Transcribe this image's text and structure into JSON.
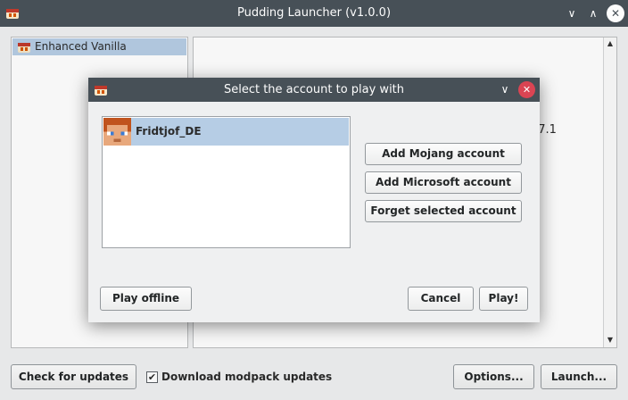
{
  "window": {
    "title": "Pudding Launcher (v1.0.0)",
    "controls": {
      "minimize": "∨",
      "maximize": "∧",
      "close": "✕"
    }
  },
  "modpacks": {
    "items": [
      {
        "label": "Enhanced Vanilla"
      }
    ]
  },
  "info_panel": {
    "visible_text": "17.1"
  },
  "bottom_bar": {
    "check_updates": "Check for updates",
    "download_updates_label": "Download modpack updates",
    "download_updates_checked": true,
    "options": "Options...",
    "launch": "Launch..."
  },
  "dialog": {
    "title": "Select the account to play with",
    "accounts": [
      {
        "name": "Fridtjof_DE",
        "selected": true
      }
    ],
    "buttons": {
      "add_mojang": "Add Mojang account",
      "add_microsoft": "Add Microsoft account",
      "forget_selected": "Forget selected account",
      "play_offline": "Play offline",
      "cancel": "Cancel",
      "play": "Play!"
    },
    "controls": {
      "minimize": "∨",
      "close": "✕"
    }
  },
  "icons": {
    "app": "pudding-icon",
    "avatar": "player-head-icon",
    "checkmark": "checkmark-icon",
    "scroll_up": "scroll-up-arrow-icon",
    "scroll_down": "scroll-down-arrow-icon"
  },
  "colors": {
    "titlebar": "#475057",
    "selection": "#b6cde5",
    "close_red": "#da4453",
    "window_bg": "#eff0f1"
  }
}
